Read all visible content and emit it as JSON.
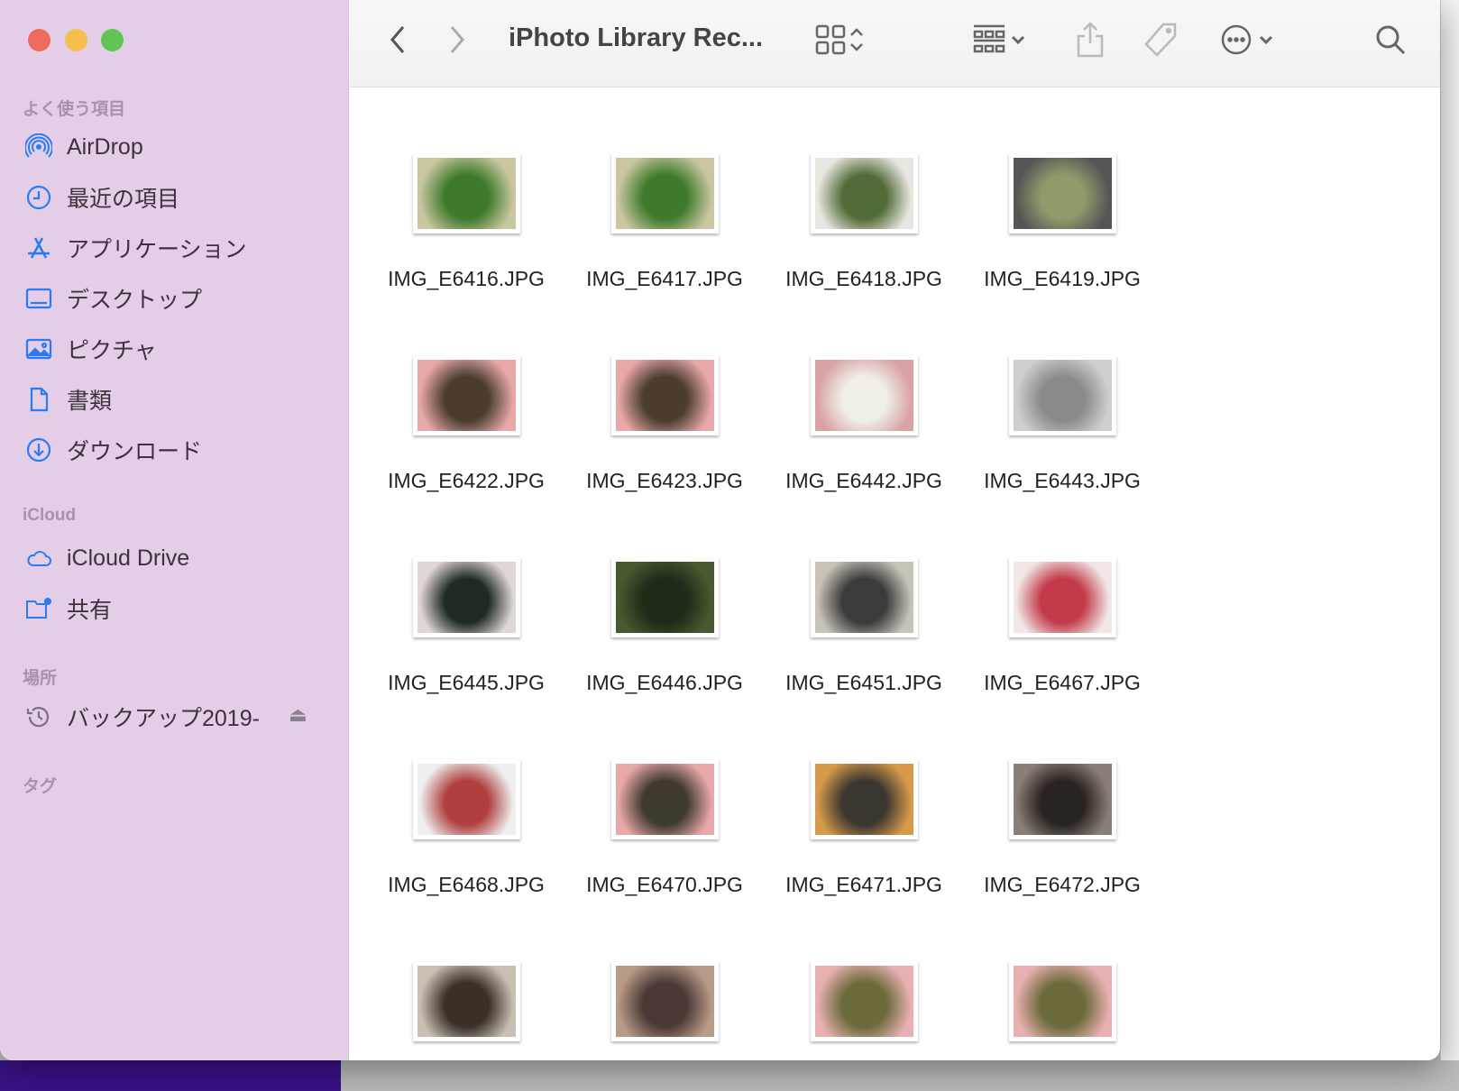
{
  "window": {
    "title": "iPhoto Library Rec..."
  },
  "sidebar": {
    "favorites_header": "よく使う項目",
    "favorites": [
      {
        "label": "AirDrop",
        "icon": "airdrop-icon"
      },
      {
        "label": "最近の項目",
        "icon": "clock-icon"
      },
      {
        "label": "アプリケーション",
        "icon": "applications-icon"
      },
      {
        "label": "デスクトップ",
        "icon": "desktop-icon"
      },
      {
        "label": "ピクチャ",
        "icon": "pictures-icon"
      },
      {
        "label": "書類",
        "icon": "document-icon"
      },
      {
        "label": "ダウンロード",
        "icon": "download-icon"
      }
    ],
    "icloud_header": "iCloud",
    "icloud": [
      {
        "label": "iCloud Drive",
        "icon": "cloud-icon"
      },
      {
        "label": "共有",
        "icon": "shared-folder-icon"
      }
    ],
    "locations_header": "場所",
    "locations": [
      {
        "label": "バックアップ2019-",
        "icon": "time-machine-icon"
      }
    ],
    "tags_header": "タグ"
  },
  "files": [
    {
      "name": "IMG_E6416.JPG",
      "colors": [
        "#c9c6a0",
        "#3f7a2c"
      ]
    },
    {
      "name": "IMG_E6417.JPG",
      "colors": [
        "#c9c6a0",
        "#3f7a2c"
      ]
    },
    {
      "name": "IMG_E6418.JPG",
      "colors": [
        "#e8e6e0",
        "#536b38"
      ]
    },
    {
      "name": "IMG_E6419.JPG",
      "colors": [
        "#555",
        "#8d9a6a"
      ]
    },
    {
      "name": "IMG_E6422.JPG",
      "colors": [
        "#e8a8a8",
        "#4a3d30"
      ]
    },
    {
      "name": "IMG_E6423.JPG",
      "colors": [
        "#e8a8a8",
        "#4a3d30"
      ]
    },
    {
      "name": "IMG_E6442.JPG",
      "colors": [
        "#d9a3a6",
        "#efefe8"
      ]
    },
    {
      "name": "IMG_E6443.JPG",
      "colors": [
        "#cfcfcf",
        "#8a8a8a"
      ]
    },
    {
      "name": "IMG_E6445.JPG",
      "colors": [
        "#e0d6d6",
        "#1f2a22"
      ]
    },
    {
      "name": "IMG_E6446.JPG",
      "colors": [
        "#4a5a30",
        "#1f2a18"
      ]
    },
    {
      "name": "IMG_E6451.JPG",
      "colors": [
        "#c7c3b7",
        "#3b3b3b"
      ]
    },
    {
      "name": "IMG_E6467.JPG",
      "colors": [
        "#f1e8e6",
        "#c23a4a"
      ]
    },
    {
      "name": "IMG_E6468.JPG",
      "colors": [
        "#efefef",
        "#b04040"
      ]
    },
    {
      "name": "IMG_E6470.JPG",
      "colors": [
        "#e8a8a8",
        "#3e3a30"
      ]
    },
    {
      "name": "IMG_E6471.JPG",
      "colors": [
        "#d69a4a",
        "#3a3630"
      ]
    },
    {
      "name": "IMG_E6472.JPG",
      "colors": [
        "#8a7f78",
        "#2a2420"
      ]
    },
    {
      "name": "",
      "colors": [
        "#c9bfb3",
        "#3a3028"
      ]
    },
    {
      "name": "",
      "colors": [
        "#b89a86",
        "#4a3a36"
      ]
    },
    {
      "name": "",
      "colors": [
        "#e8b0b0",
        "#6a6a3a"
      ]
    },
    {
      "name": "",
      "colors": [
        "#e8b0b0",
        "#6a6a3a"
      ]
    }
  ]
}
